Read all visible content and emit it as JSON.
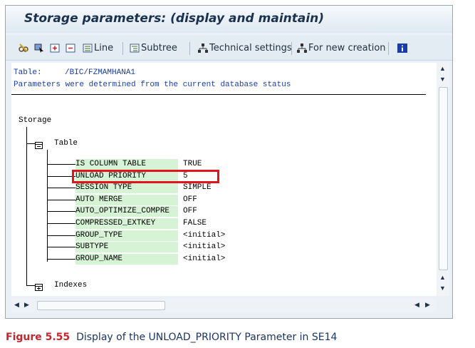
{
  "window": {
    "title": "Storage parameters: (display and maintain)"
  },
  "toolbar": {
    "icons": [
      "glasses-edit-icon",
      "cursor-icon",
      "expand-subtree-icon",
      "collapse-icon"
    ],
    "line_label": "Line",
    "subtree_label": "Subtree",
    "technical_settings_label": "Technical settings",
    "for_new_creation_label": "For new creation",
    "info_icon": "info-icon"
  },
  "header": {
    "table_label": "Table:",
    "table_value": "/BIC/FZMAMHANA1",
    "status_message": "Parameters were determined from the current database status"
  },
  "tree": {
    "root_label": "Storage",
    "table_node_label": "Table",
    "indexes_node_label": "Indexes",
    "parameters": [
      {
        "key": "IS COLUMN TABLE",
        "value": "TRUE"
      },
      {
        "key": "UNLOAD PRIORITY",
        "value": "5",
        "highlighted": true
      },
      {
        "key": "SESSION TYPE",
        "value": "SIMPLE"
      },
      {
        "key": "AUTO MERGE",
        "value": "OFF"
      },
      {
        "key": "AUTO_OPTIMIZE_COMPRE",
        "value": "OFF"
      },
      {
        "key": "COMPRESSED_EXTKEY",
        "value": "FALSE"
      },
      {
        "key": "GROUP_TYPE",
        "value": "<initial>"
      },
      {
        "key": "SUBTYPE",
        "value": "<initial>"
      },
      {
        "key": "GROUP_NAME",
        "value": "<initial>"
      }
    ]
  },
  "colors": {
    "highlight_box": "#e2131b",
    "key_background": "#d7f3d5",
    "message_text": "#1a3ca8"
  },
  "caption": {
    "figure_number": "Figure 5.55",
    "text": "Display of the UNLOAD_PRIORITY Parameter in SE14"
  }
}
